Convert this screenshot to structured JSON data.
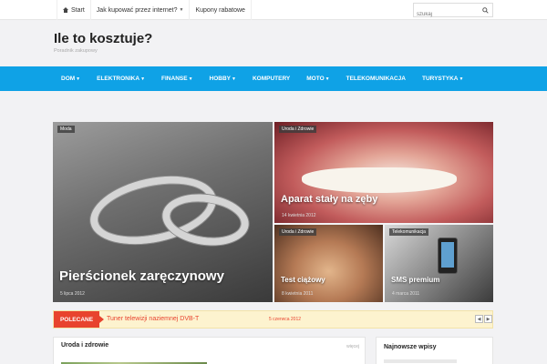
{
  "topbar": {
    "items": [
      {
        "label": "Start",
        "icon": "home-icon"
      },
      {
        "label": "Jak kupować przez internet?",
        "dropdown": true
      },
      {
        "label": "Kupony rabatowe"
      }
    ],
    "search_placeholder": "szukaj"
  },
  "header": {
    "title": "Ile to kosztuje?",
    "tagline": "Poradnik zakupowy"
  },
  "mainnav": {
    "items": [
      {
        "label": "DOM",
        "dropdown": true
      },
      {
        "label": "ELEKTRONIKA",
        "dropdown": true
      },
      {
        "label": "FINANSE",
        "dropdown": true
      },
      {
        "label": "HOBBY",
        "dropdown": true
      },
      {
        "label": "KOMPUTERY",
        "dropdown": false
      },
      {
        "label": "MOTO",
        "dropdown": true
      },
      {
        "label": "TELEKOMUNIKACJA",
        "dropdown": false
      },
      {
        "label": "TURYSTYKA",
        "dropdown": true
      }
    ],
    "color": "#0fa2e6"
  },
  "featured": {
    "main": {
      "category": "Moda",
      "title": "Pierścionek zaręczynowy",
      "date": "5 lipca 2012"
    },
    "top_right": {
      "category": "Uroda i Zdrowie",
      "title": "Aparat stały na zęby",
      "date": "14 kwietnia 2012"
    },
    "bottom_left": {
      "category": "Uroda i Zdrowie",
      "title": "Test ciążowy",
      "date": "8 kwietnia 2011"
    },
    "bottom_right": {
      "category": "Telekomunikacja",
      "title": "SMS premium",
      "date": "4 marca 2011"
    }
  },
  "recommended": {
    "label": "POLECANE",
    "text": "Tuner telewizji naziemnej DVB-T",
    "date": "5 czerwca 2012",
    "accent": "#e8432e"
  },
  "sections": {
    "health": {
      "title": "Uroda i zdrowie",
      "more": "więcej"
    },
    "latest": {
      "title": "Najnowsze wpisy"
    }
  }
}
